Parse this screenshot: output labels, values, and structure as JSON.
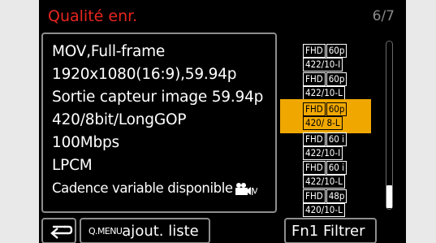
{
  "header": {
    "title": "Qualité enr.",
    "page": "6/7"
  },
  "details": [
    "MOV,Full-frame",
    "1920x1080(16:9),59.94p",
    "Sortie capteur image 59.94p",
    "420/8bit/LongGOP",
    "100Mbps",
    "LPCM",
    "Cadence variable disponible"
  ],
  "options": [
    {
      "res": "FHD",
      "fps": "60p",
      "spec": "422/10-I",
      "selected": false
    },
    {
      "res": "FHD",
      "fps": "60p",
      "spec": "422/10-L",
      "selected": false
    },
    {
      "res": "FHD",
      "fps": "60p",
      "spec": "420/ 8-L",
      "selected": true
    },
    {
      "res": "FHD",
      "fps": "60 i",
      "spec": "422/10-I",
      "selected": false
    },
    {
      "res": "FHD",
      "fps": "60 i",
      "spec": "422/10-L",
      "selected": false
    },
    {
      "res": "FHD",
      "fps": "48p",
      "spec": "420/10-L",
      "selected": false
    }
  ],
  "footer": {
    "back_icon": "return-arrow-icon",
    "qmenu_label": "Q.MENU",
    "add_list_label": "ajout. liste",
    "fn_label": "Fn1",
    "filter_label": "Filtrer"
  },
  "colors": {
    "accent": "#e8251e",
    "selected": "#f0a800"
  }
}
